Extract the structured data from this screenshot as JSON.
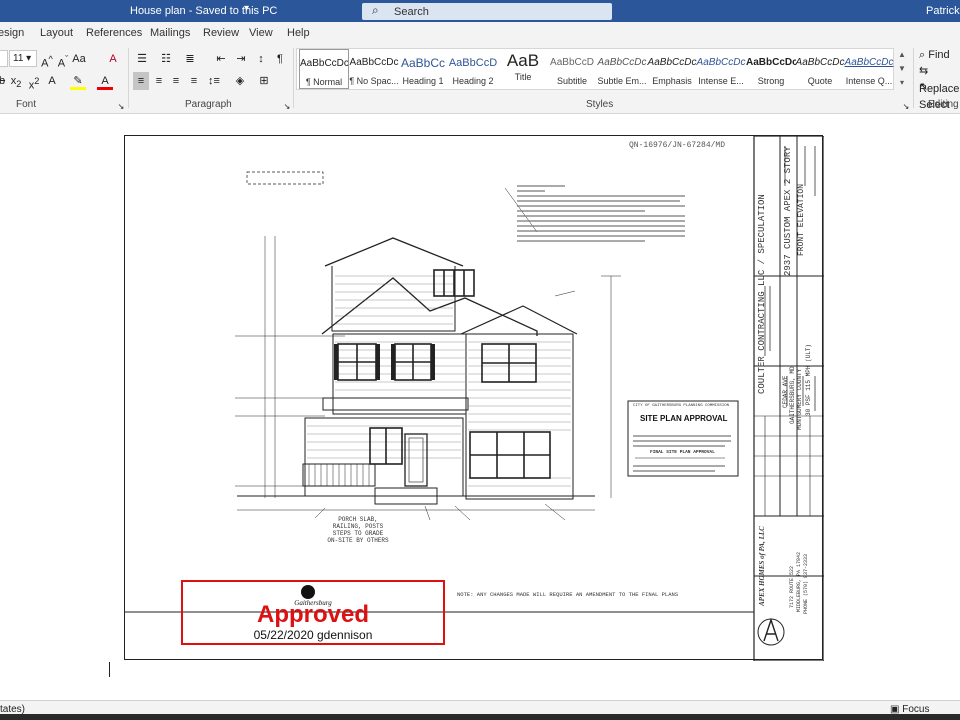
{
  "titlebar": {
    "doc_title": "House plan  -  Saved to this PC",
    "search_placeholder": "Search",
    "user": "Patrick C"
  },
  "tabs": [
    "esign",
    "Layout",
    "References",
    "Mailings",
    "Review",
    "View",
    "Help"
  ],
  "ribbon": {
    "font": {
      "size": "11",
      "label": "Font"
    },
    "paragraph": {
      "label": "Paragraph"
    },
    "styles": {
      "label": "Styles",
      "items": [
        {
          "preview": "AaBbCcDc",
          "name": "¶ Normal"
        },
        {
          "preview": "AaBbCcDc",
          "name": "¶ No Spac..."
        },
        {
          "preview": "AaBbCc",
          "name": "Heading 1"
        },
        {
          "preview": "AaBbCcD",
          "name": "Heading 2"
        },
        {
          "preview": "AaB",
          "name": "Title"
        },
        {
          "preview": "AaBbCcD",
          "name": "Subtitle"
        },
        {
          "preview": "AaBbCcDc",
          "name": "Subtle Em..."
        },
        {
          "preview": "AaBbCcDc",
          "name": "Emphasis"
        },
        {
          "preview": "AaBbCcDc",
          "name": "Intense E..."
        },
        {
          "preview": "AaBbCcDc",
          "name": "Strong"
        },
        {
          "preview": "AaBbCcDc",
          "name": "Quote"
        },
        {
          "preview": "AaBbCcDc",
          "name": "Intense Q..."
        }
      ]
    },
    "editing": {
      "find": "Find",
      "replace": "Replace",
      "select": "Select",
      "label": "Editing"
    }
  },
  "drawing": {
    "drawing_no": "QN-16976/JN-67284/MD",
    "company": "COULTER CONTRACTING LLC / SPECULATION",
    "project": "2937 CUSTOM APEX 2 STORY",
    "sheet_title": "FRONT ELEVATION",
    "address_lines": [
      "CEDAR AVE",
      "GAITHERSBURG, MD",
      "MONTGOMERY COUNTY"
    ],
    "design_loads": "30 PSF   115 MPH (ULT)",
    "manufacturer": [
      "APEX HOMES of PA, LLC",
      "7172 ROUTE 522",
      "MIDDLEBURG, PA 17842",
      "PHONE (570) 837-2333"
    ],
    "note": "NOTE: ANY CHANGES MADE WILL REQUIRE AN AMENDMENT TO THE FINAL PLANS",
    "site_plan_box": {
      "header": "CITY OF GAITHERSBURG PLANNING COMMISSION",
      "title": "SITE PLAN APPROVAL",
      "subtitle": "FINAL SITE PLAN APPROVAL"
    },
    "leader_notes": [
      "PORCH SLAB,",
      "RAILING, POSTS",
      "STEPS TO GRADE",
      "ON-SITE BY OTHERS"
    ],
    "stamp": {
      "logo_text": "Gaithersburg",
      "status": "Approved",
      "date_user": "05/22/2020 gdennison"
    }
  },
  "statusbar": {
    "left": "tates)",
    "focus": "Focus"
  }
}
